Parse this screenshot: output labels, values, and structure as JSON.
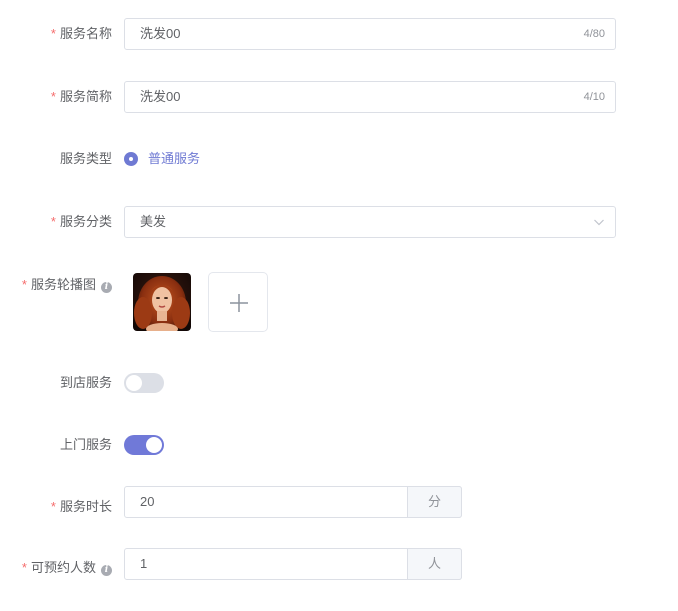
{
  "form": {
    "service_name": {
      "label": "服务名称",
      "value": "洗发00",
      "count": "4/80"
    },
    "service_short": {
      "label": "服务简称",
      "value": "洗发00",
      "count": "4/10"
    },
    "service_type": {
      "label": "服务类型",
      "option": "普通服务"
    },
    "service_category": {
      "label": "服务分类",
      "value": "美发"
    },
    "carousel": {
      "label": "服务轮播图"
    },
    "in_store": {
      "label": "到店服务",
      "enabled": false
    },
    "home_service": {
      "label": "上门服务",
      "enabled": true
    },
    "duration": {
      "label": "服务时长",
      "value": "20",
      "unit": "分"
    },
    "capacity": {
      "label": "可预约人数",
      "value": "1",
      "unit": "人"
    }
  },
  "required_mark": "*",
  "info_glyph": "i",
  "colors": {
    "accent": "#6f7ad3",
    "required": "#f56c6c",
    "border": "#dcdfe6"
  },
  "icons": {
    "info": "info-icon",
    "chevron": "chevron-down-icon",
    "plus": "plus-icon"
  }
}
